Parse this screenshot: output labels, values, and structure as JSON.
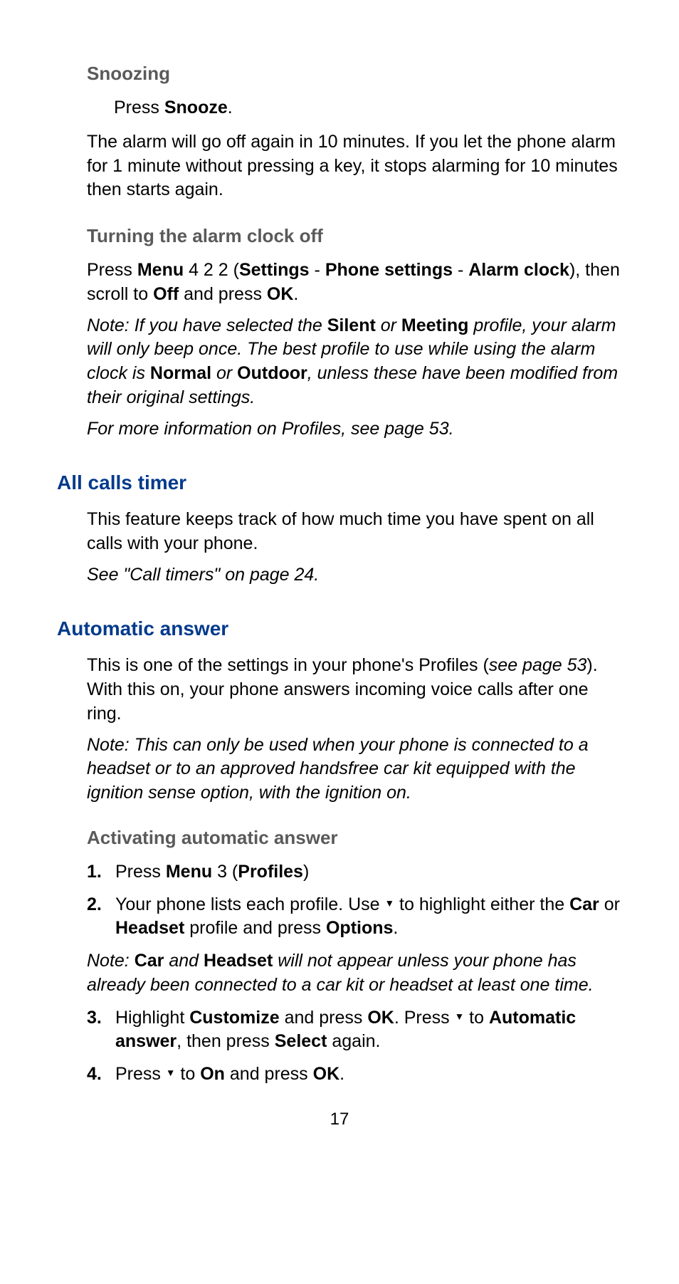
{
  "snoozing": {
    "title": "Snoozing",
    "press1": "Press ",
    "press2": "Snooze",
    "press3": ".",
    "body": "The alarm will go off again in 10 minutes. If you let the phone alarm for 1 minute without pressing a key, it stops alarming for 10 minutes then starts again."
  },
  "turnoff": {
    "title": "Turning the alarm clock off",
    "p1a": "Press ",
    "p1b": "Menu",
    "p1c": " 4 2 2 (",
    "p1d": "Settings",
    "p1e": " - ",
    "p1f": "Phone settings",
    "p1g": " - ",
    "p1h": "Alarm clock",
    "p1i": "), then scroll to ",
    "p1j": "Off",
    "p1k": " and press ",
    "p1l": "OK",
    "p1m": ".",
    "note1a": "Note: If you have selected the ",
    "note1b": "Silent",
    "note1c": " or ",
    "note1d": "Meeting",
    "note1e": " profile, your alarm will only beep once. The best profile to use while using the alarm clock is ",
    "note1f": "Normal",
    "note1g": " or ",
    "note1h": "Outdoor",
    "note1i": ", unless these have been modified from their original settings.",
    "more": "For more information on Profiles, see page 53."
  },
  "allcalls": {
    "title": "All calls timer",
    "body": "This feature keeps track of how much time you have spent on all calls with your phone.",
    "see": "See \"Call timers\" on page 24."
  },
  "auto": {
    "title": "Automatic answer",
    "p1a": "This is one of the settings in your phone's Profiles (",
    "p1b": "see page 53",
    "p1c": "). With this on, your phone answers incoming voice calls after one ring.",
    "note": "Note: This can only be used when your phone is connected to a headset or to an approved handsfree car kit equipped with the ignition sense option, with the ignition on.",
    "activating": "Activating automatic answer",
    "s1a": "Press ",
    "s1b": "Menu",
    "s1c": " 3 (",
    "s1d": "Profiles",
    "s1e": ")",
    "s2a": "Your phone lists each profile. Use ",
    "s2b": " to highlight either the ",
    "s2c": "Car",
    "s2d": " or ",
    "s2e": "Headset",
    "s2f": " profile and press ",
    "s2g": "Options",
    "s2h": ".",
    "midnote_a": "Note: ",
    "midnote_b": "Car",
    "midnote_c": " and ",
    "midnote_d": "Headset",
    "midnote_e": " will not appear unless your phone has already been connected to a car kit or headset at least one time.",
    "s3a": "Highlight ",
    "s3b": "Customize",
    "s3c": " and press ",
    "s3d": "OK",
    "s3e": ". Press ",
    "s3f": " to ",
    "s3g": "Automatic answer",
    "s3h": ", then press ",
    "s3i": "Select",
    "s3j": " again.",
    "s4a": "Press ",
    "s4b": " to ",
    "s4c": "On",
    "s4d": " and press ",
    "s4e": "OK",
    "s4f": "."
  },
  "icons": {
    "down": "▼"
  },
  "page_number": "17"
}
